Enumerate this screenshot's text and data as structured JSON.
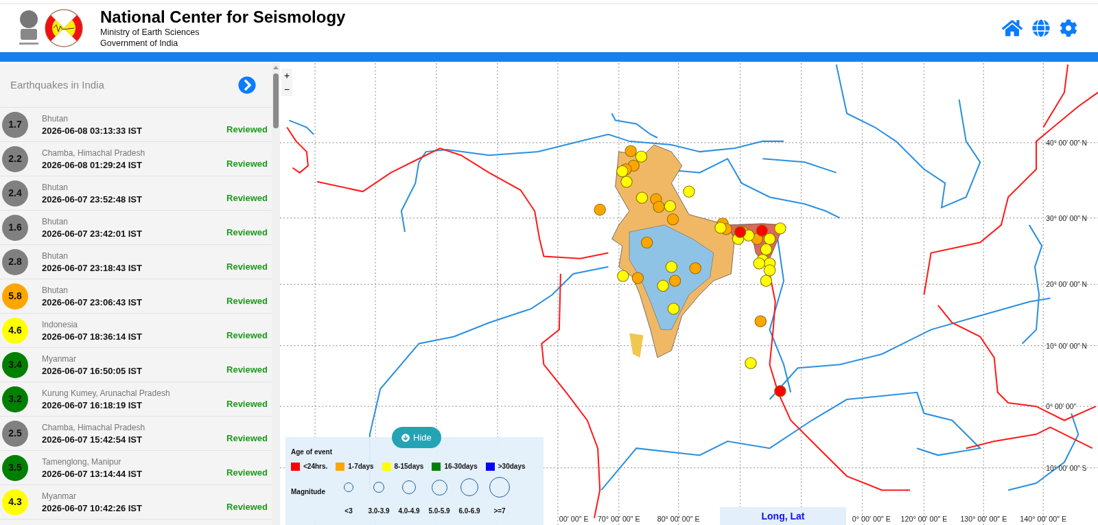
{
  "header": {
    "title": "National Center for Seismology",
    "subtitle_lines": [
      "Ministry of Earth Sciences",
      "Government of India"
    ]
  },
  "sidebar": {
    "title": "Earthquakes in India",
    "events": [
      {
        "magnitude": "1.7",
        "color": "#808080",
        "location": "Bhutan",
        "time": "2026-06-08 03:13:33 IST",
        "status": "Reviewed"
      },
      {
        "magnitude": "2.2",
        "color": "#808080",
        "location": "Chamba, Himachal Pradesh",
        "time": "2026-06-08 01:29:24 IST",
        "status": "Reviewed"
      },
      {
        "magnitude": "2.4",
        "color": "#808080",
        "location": "Bhutan",
        "time": "2026-06-07 23:52:48 IST",
        "status": "Reviewed"
      },
      {
        "magnitude": "1.6",
        "color": "#808080",
        "location": "Bhutan",
        "time": "2026-06-07 23:42:01 IST",
        "status": "Reviewed"
      },
      {
        "magnitude": "2.8",
        "color": "#808080",
        "location": "Bhutan",
        "time": "2026-06-07 23:18:43 IST",
        "status": "Reviewed"
      },
      {
        "magnitude": "5.8",
        "color": "#ffa500",
        "location": "Bhutan",
        "time": "2026-06-07 23:06:43 IST",
        "status": "Reviewed"
      },
      {
        "magnitude": "4.6",
        "color": "#ffff00",
        "location": "Indonesia",
        "time": "2026-06-07 18:36:14 IST",
        "status": "Reviewed"
      },
      {
        "magnitude": "3.4",
        "color": "#008000",
        "location": "Myanmar",
        "time": "2026-06-07 16:50:05 IST",
        "status": "Reviewed"
      },
      {
        "magnitude": "3.2",
        "color": "#008000",
        "location": "Kurung Kumey, Arunachal Pradesh",
        "time": "2026-06-07 16:18:19 IST",
        "status": "Reviewed"
      },
      {
        "magnitude": "2.5",
        "color": "#808080",
        "location": "Chamba, Himachal Pradesh",
        "time": "2026-06-07 15:42:54 IST",
        "status": "Reviewed"
      },
      {
        "magnitude": "3.5",
        "color": "#008000",
        "location": "Tamenglong, Manipur",
        "time": "2026-06-07 13:14:44 IST",
        "status": "Reviewed"
      },
      {
        "magnitude": "4.3",
        "color": "#ffff00",
        "location": "Myanmar",
        "time": "2026-06-07 10:42:26 IST",
        "status": "Reviewed"
      }
    ]
  },
  "map": {
    "zoom_controls": [
      "+",
      "−"
    ],
    "hide_button": "Hide",
    "legend": {
      "age_title": "Age of event",
      "age_items": [
        {
          "label": "<24hrs.",
          "color": "#ff0000"
        },
        {
          "label": "1-7days",
          "color": "#ffa500"
        },
        {
          "label": "8-15days",
          "color": "#ffff00"
        },
        {
          "label": "16-30days",
          "color": "#008000"
        },
        {
          "label": ">30days",
          "color": "#0000ff"
        }
      ],
      "magnitude_title": "Magnitude",
      "magnitude_items": [
        "<3",
        "3.0-3.9",
        "4.0-4.9",
        "5.0-5.9",
        "6.0-6.9",
        ">=7"
      ]
    },
    "longitude_labels": [
      "00′ 00″ E",
      "70° 00′ 00″ E",
      "80° 00′ 00″ E",
      "0° 00′ 00″ E",
      "120° 00′ 00″ E",
      "130° 00′ 00″ E",
      "140° 00′ 00″ E"
    ],
    "latitude_labels": [
      "40° 00′ 00″ N",
      "30° 00′ 00″ N",
      "20° 00′ 00″ N",
      "10° 00′ 00″ N",
      "0° 00′ 00″",
      "10° 00′ 00″ S"
    ],
    "coordinate_box": "Long, Lat"
  }
}
